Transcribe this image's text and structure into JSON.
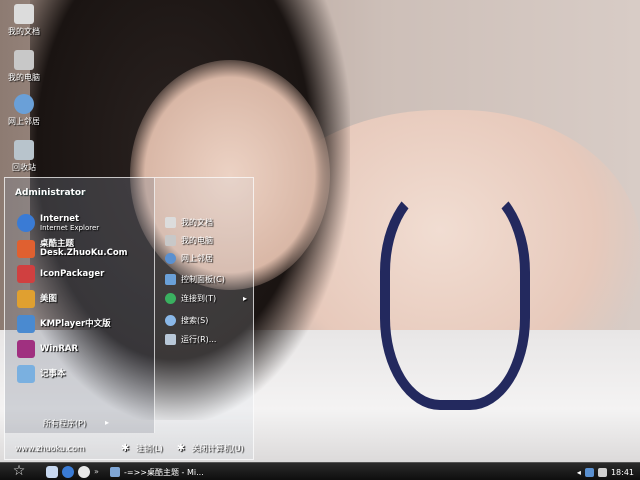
{
  "desktop": {
    "icons": [
      {
        "label": "我的文档",
        "icon": "my-documents-icon",
        "color": "#dcdcdc"
      },
      {
        "label": "我的电脑",
        "icon": "my-computer-icon",
        "color": "#c8c8c8"
      },
      {
        "label": "网上邻居",
        "icon": "network-icon",
        "color": "#6aa0d8"
      },
      {
        "label": "回收站",
        "icon": "recycle-bin-icon",
        "color": "#b8c4cc"
      }
    ]
  },
  "start_menu": {
    "user": "Administrator",
    "pinned": [
      {
        "label": "Internet",
        "sub": "Internet Explorer",
        "icon": "internet-explorer-icon",
        "color": "#3a7bd5"
      },
      {
        "label": "桌酷主题Desk.ZhuoKu.Com",
        "icon": "zhuoku-theme-icon",
        "color": "#e06030"
      },
      {
        "label": "IconPackager",
        "icon": "iconpackager-icon",
        "color": "#d04040"
      },
      {
        "label": "美图",
        "icon": "meitu-icon",
        "color": "#e0a030"
      },
      {
        "label": "KMPlayer中文版",
        "icon": "kmplayer-icon",
        "color": "#4a8ad0"
      },
      {
        "label": "WinRAR",
        "icon": "winrar-icon",
        "color": "#a03080"
      },
      {
        "label": "记事本",
        "icon": "notepad-icon",
        "color": "#7ab0e0"
      }
    ],
    "right": [
      {
        "label": "我的文档",
        "icon": "my-documents-icon",
        "color": "#dcdcdc"
      },
      {
        "label": "我的电脑",
        "icon": "my-computer-icon",
        "color": "#c8c8c8"
      },
      {
        "label": "网上邻居",
        "icon": "network-icon",
        "color": "#5a90d0"
      },
      {
        "label": "控制面板(C)",
        "icon": "control-panel-icon",
        "color": "#6aa0d8"
      },
      {
        "label": "连接到(T)",
        "icon": "connect-to-icon",
        "color": "#3ab060",
        "arrow": "▸"
      },
      {
        "label": "搜索(S)",
        "icon": "search-icon",
        "color": "#8ab8e8"
      },
      {
        "label": "运行(R)...",
        "icon": "run-icon",
        "color": "#b8c8d8"
      }
    ],
    "all_programs": "所有程序(P)",
    "all_programs_arrow": "▸",
    "site": "www.zhuoku.com",
    "logoff": "注销(L)",
    "shutdown": "关闭计算机(U)"
  },
  "taskbar": {
    "window_label": "-=>>桌酷主题 - Mi...",
    "clock": "18:41",
    "tray_arrow": "◂"
  }
}
